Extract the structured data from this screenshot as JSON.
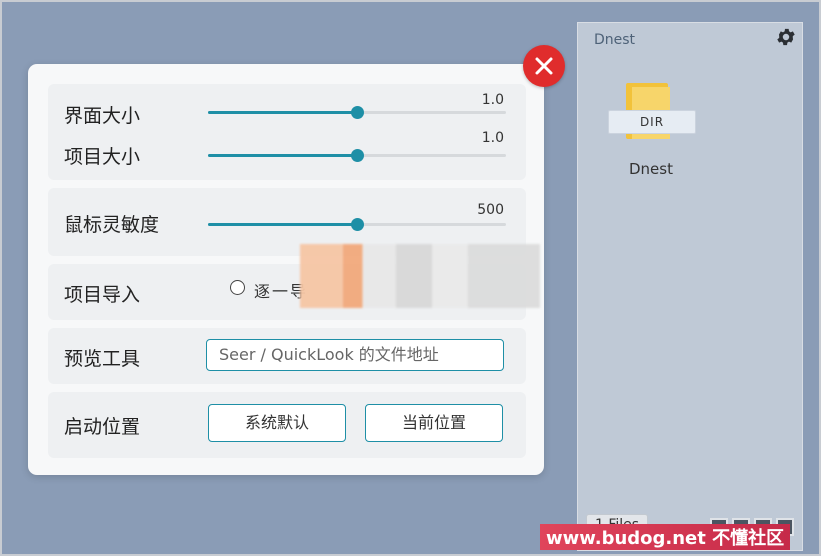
{
  "panel": {
    "title": "Dnest",
    "folder": {
      "badge": "DIR",
      "name": "Dnest"
    },
    "files_count": "1 Files"
  },
  "dialog": {
    "ui_size": {
      "label": "界面大小",
      "value": 1.0,
      "value_text": "1.0",
      "fraction": 0.5
    },
    "item_size": {
      "label": "项目大小",
      "value": 1.0,
      "value_text": "1.0",
      "fraction": 0.5
    },
    "mouse_sensitivity": {
      "label": "鼠标灵敏度",
      "value": 500,
      "value_text": "500",
      "fraction": 0.5
    },
    "item_import": {
      "label": "项目导入",
      "option1": "逐一导"
    },
    "preview_tool": {
      "label": "预览工具",
      "placeholder": "Seer / QuickLook 的文件地址"
    },
    "startup_position": {
      "label": "启动位置",
      "btn_system": "系统默认",
      "btn_current": "当前位置"
    }
  },
  "colors": {
    "accent": "#1e8fa6",
    "close": "#e02c2c",
    "background": "#8a9cb6"
  },
  "watermark": "www.budog.net 不懂社区"
}
